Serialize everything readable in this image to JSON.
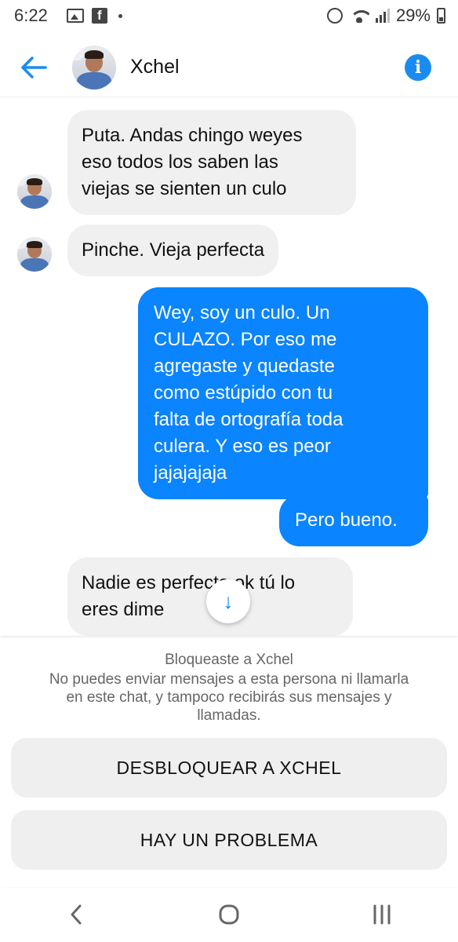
{
  "status_bar": {
    "time": "6:22",
    "battery": "29%",
    "icons": [
      "image-icon",
      "facebook-icon",
      "dot-icon",
      "alarm-icon",
      "wifi-icon",
      "signal-icon",
      "battery-icon"
    ]
  },
  "header": {
    "contact_name": "Xchel",
    "back_icon": "arrow-left-icon",
    "info_icon": "info-icon",
    "info_glyph": "i",
    "accent_color": "#1a8cf0"
  },
  "messages": [
    {
      "side": "in",
      "lines": [
        "Puta. Andas chingo weyes",
        "eso todos los saben las",
        "viejas se sienten un culo"
      ]
    },
    {
      "side": "in",
      "lines": [
        "Pinche. Vieja perfecta"
      ]
    },
    {
      "side": "out",
      "lines": [
        "Wey, soy un culo. Un",
        "CULAZO. Por eso me",
        "agregaste y quedaste",
        "como estúpido con tu",
        "falta de ortografía toda",
        "culera. Y eso es peor",
        "jajajajaja"
      ]
    },
    {
      "side": "out",
      "lines": [
        "Pero bueno."
      ]
    },
    {
      "side": "in",
      "lines": [
        "Nadie es perfecto ok tú lo",
        "eres dime"
      ]
    }
  ],
  "scroll_down": {
    "icon": "arrow-down-icon",
    "glyph": "↓"
  },
  "blocked": {
    "title": "Bloqueaste a Xchel",
    "description": "No puedes enviar mensajes a esta persona ni llamarla en este chat, y tampoco recibirás sus mensajes y llamadas.",
    "unblock_label": "DESBLOQUEAR A XCHEL",
    "problem_label": "HAY UN PROBLEMA"
  },
  "nav": {
    "back_glyph": "<",
    "home_glyph": "○",
    "recents_glyph": "|||"
  },
  "colors": {
    "outgoing_bubble": "#0a84ff",
    "incoming_bubble": "#f0f0f0"
  }
}
